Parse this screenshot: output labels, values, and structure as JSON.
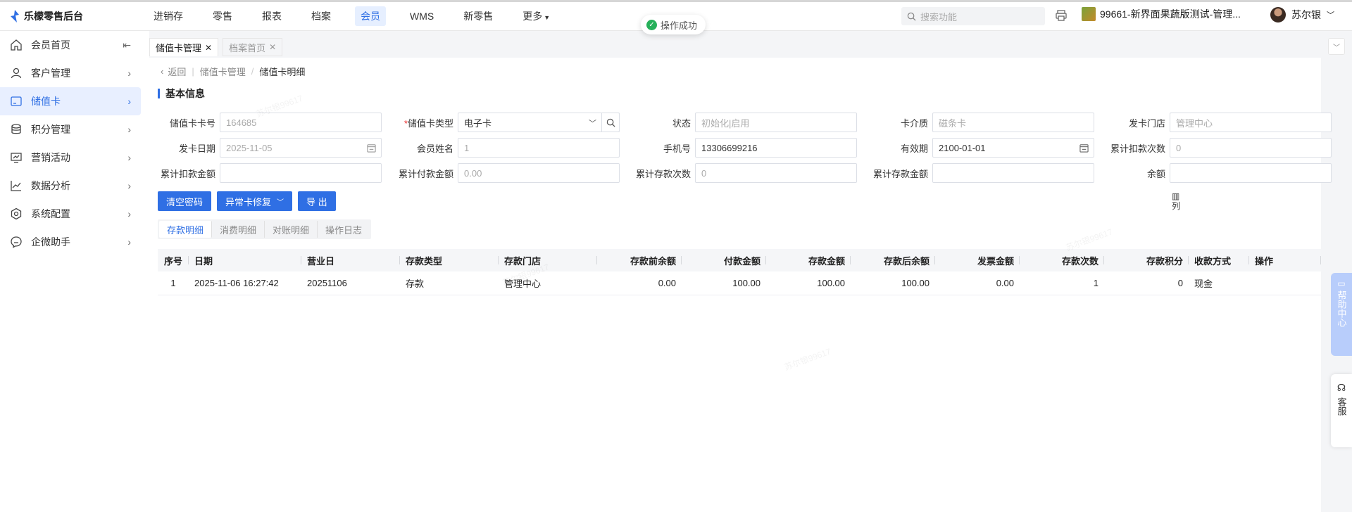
{
  "app": {
    "title": "乐檬零售后台"
  },
  "topnav": {
    "items": [
      "进销存",
      "零售",
      "报表",
      "档案",
      "会员",
      "WMS",
      "新零售",
      "更多"
    ],
    "active": "会员"
  },
  "toast": "操作成功",
  "search": {
    "placeholder": "搜索功能"
  },
  "store": "99661-新界面果蔬版测试-管理...",
  "user": "苏尔银",
  "sidebar": {
    "items": [
      "会员首页",
      "客户管理",
      "储值卡",
      "积分管理",
      "营销活动",
      "数据分析",
      "系统配置",
      "企微助手"
    ]
  },
  "tabs": [
    {
      "label": "储值卡管理",
      "close": "✕"
    },
    {
      "label": "档案首页",
      "close": "✕"
    }
  ],
  "breadcrumb": {
    "back": "返回",
    "parent": "储值卡管理",
    "sep": "/",
    "current": "储值卡明细"
  },
  "section": "基本信息",
  "form": {
    "card_no": {
      "label": "储值卡卡号",
      "value": "164685"
    },
    "card_type": {
      "label": "储值卡类型",
      "required": "*",
      "value": "电子卡"
    },
    "status": {
      "label": "状态",
      "value": "初始化|启用"
    },
    "medium": {
      "label": "卡介质",
      "value": "磁条卡"
    },
    "issue_store": {
      "label": "发卡门店",
      "value": "管理中心"
    },
    "issue_date": {
      "label": "发卡日期",
      "value": "2025-11-05"
    },
    "member_name": {
      "label": "会员姓名",
      "value": "1"
    },
    "phone": {
      "label": "手机号",
      "value": "13306699216"
    },
    "valid_until": {
      "label": "有效期",
      "value": "2100-01-01"
    },
    "deduct_count": {
      "label": "累计扣款次数",
      "value": "0"
    },
    "deduct_amount": {
      "label": "累计扣款金额",
      "value": ""
    },
    "pay_amount": {
      "label": "累计付款金额",
      "value": "0.00"
    },
    "deposit_count": {
      "label": "累计存款次数",
      "value": "0"
    },
    "deposit_amount": {
      "label": "累计存款金额",
      "value": ""
    },
    "balance": {
      "label": "余额",
      "value": ""
    }
  },
  "buttons": {
    "clear_password": "清空密码",
    "repair": "异常卡修复",
    "export": "导 出"
  },
  "subtabs": [
    "存款明细",
    "消费明细",
    "对账明细",
    "操作日志"
  ],
  "table": {
    "columns": [
      "序号",
      "日期",
      "营业日",
      "存款类型",
      "存款门店",
      "存款前余额",
      "付款金额",
      "存款金额",
      "存款后余额",
      "发票金额",
      "存款次数",
      "存款积分",
      "收款方式",
      "操作"
    ],
    "rows": [
      [
        "1",
        "2025-11-06 16:27:42",
        "20251106",
        "存款",
        "管理中心",
        "0.00",
        "100.00",
        "100.00",
        "100.00",
        "0.00",
        "1",
        "0",
        "现金",
        ""
      ]
    ]
  },
  "column_selector": "列",
  "help": "帮助中心",
  "service": "客服",
  "watermark": "苏尔银99617"
}
